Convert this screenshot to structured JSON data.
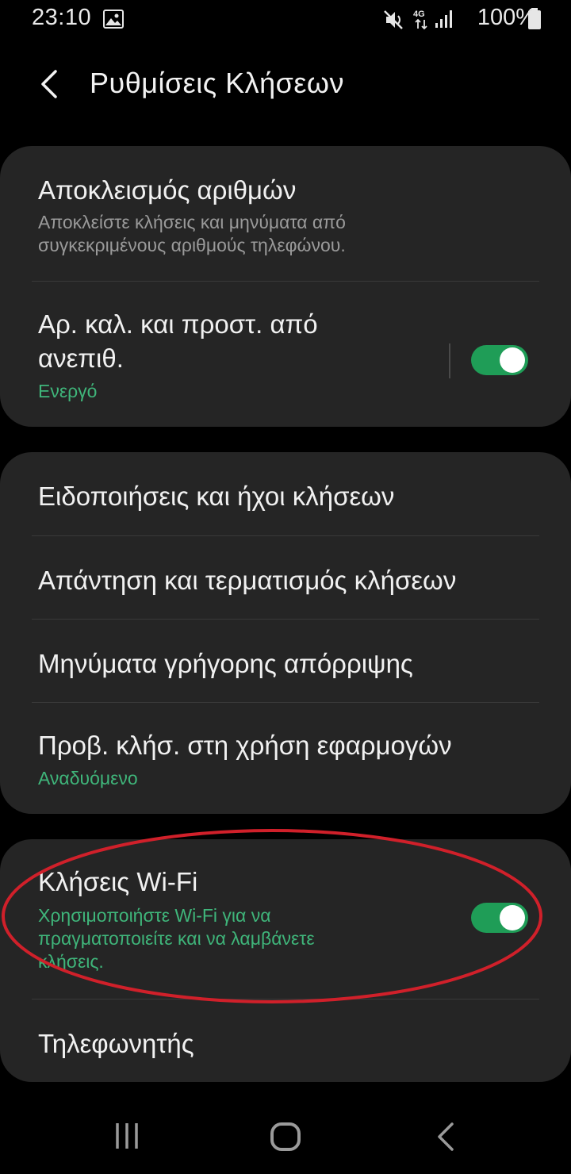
{
  "status_bar": {
    "time": "23:10",
    "battery": "100%",
    "icons": [
      "image-icon",
      "mute-icon",
      "4g-icon",
      "signal-icon",
      "battery-icon"
    ]
  },
  "header": {
    "title": "Ρυθμίσεις Κλήσεων",
    "back_icon": "back-arrow-icon"
  },
  "groups": {
    "block": {
      "title": "Αποκλεισμός αριθμών",
      "subtitle_line1": "Αποκλείστε κλήσεις και μηνύματα από",
      "subtitle_line2": "συγκεκριμένους αριθμούς τηλεφώνου."
    },
    "caller_id": {
      "title_line1": "Αρ. καλ. και προστ. από",
      "title_line2": "ανεπιθ.",
      "status": "Ενεργό",
      "toggle_on": true
    },
    "notifications": {
      "title": "Ειδοποιήσεις και ήχοι κλήσεων"
    },
    "answering": {
      "title": "Απάντηση και τερματισμός κλήσεων"
    },
    "quick_decline": {
      "title": "Μηνύματα γρήγορης απόρριψης"
    },
    "app_calls": {
      "title": "Προβ. κλήσ. στη χρήση εφαρμογών",
      "status": "Αναδυόμενο"
    },
    "wifi_calling": {
      "title": "Κλήσεις Wi-Fi",
      "subtitle_line1": "Χρησιμοποιήστε Wi-Fi για να",
      "subtitle_line2": "πραγματοποιείτε και να λαμβάνετε",
      "subtitle_line3": "κλήσεις.",
      "toggle_on": true
    },
    "voicemail": {
      "title": "Τηλεφωνητής"
    }
  },
  "colors": {
    "background": "#000000",
    "card": "#252525",
    "accent_green": "#3fb57a",
    "toggle_green": "#1f9d57",
    "highlight_red": "#d0202a"
  },
  "nav_bar": {
    "icons": [
      "recents-icon",
      "home-icon",
      "nav-back-icon"
    ]
  }
}
